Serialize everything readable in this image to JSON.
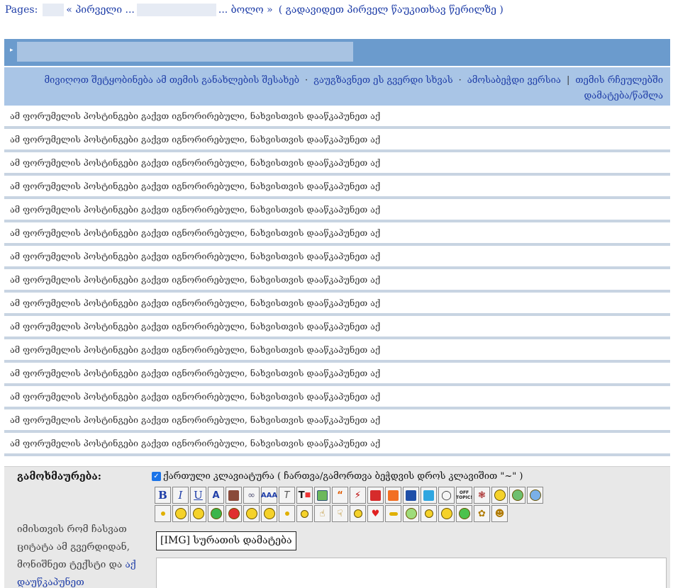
{
  "pagination": {
    "label": "Pages:",
    "first": "« პირველი ...",
    "last": "... ბოლო »",
    "jump": "( გადავიდეთ პირველ წაუკითხავ წერილზე )"
  },
  "toolbar": {
    "notify": "მივიღოთ შეტყობინება ამ თემის განახლების შესახებ",
    "send": "გაუგზავნეთ ეს გვერდი სხვას",
    "print": "ამოსაბეჭდი ვერსია",
    "favorites": "თემის რჩეულებში დამატება/წაშლა"
  },
  "posts": {
    "ignored_text": "ამ ფორუმელის პოსტინგები გაქვთ იგნორირებული, ნახვისთვის დააწკაპუნეთ აქ"
  },
  "reply": {
    "label": "გამოხმაურება:",
    "keyboard_label": "ქართული კლავიატურა",
    "keyboard_hint": "( ჩართვა/გამორთვა ბეჭდვის დროს კლავიშით \"~\" )",
    "help_text": "იმისთვის რომ ჩასვათ ციტატა ამ გვერდიდან, მონიშნეთ ტექსტი და",
    "help_link": "აქ დაუწკაპუნეთ",
    "img_button": "[IMG] სურათის დამატება"
  },
  "editor_icons": {
    "row1": [
      "bold",
      "italic",
      "underline",
      "strike",
      "face-photo",
      "link",
      "font-size",
      "font",
      "text-color",
      "image",
      "quote",
      "flash",
      "youtube",
      "soundcloud",
      "facebook",
      "vimeo",
      "drop",
      "offtopic",
      "confused",
      "sleepy",
      "worried",
      "cool"
    ],
    "row2": [
      "tiny",
      "smile",
      "happy",
      "shy",
      "angry",
      "nerd",
      "cry",
      "small",
      "thinking",
      "thumbs-up",
      "thumbs-down",
      "grin",
      "love",
      "kiss",
      "sick",
      "dizzy",
      "surprised",
      "wink",
      "sneaky",
      "tongue"
    ]
  }
}
